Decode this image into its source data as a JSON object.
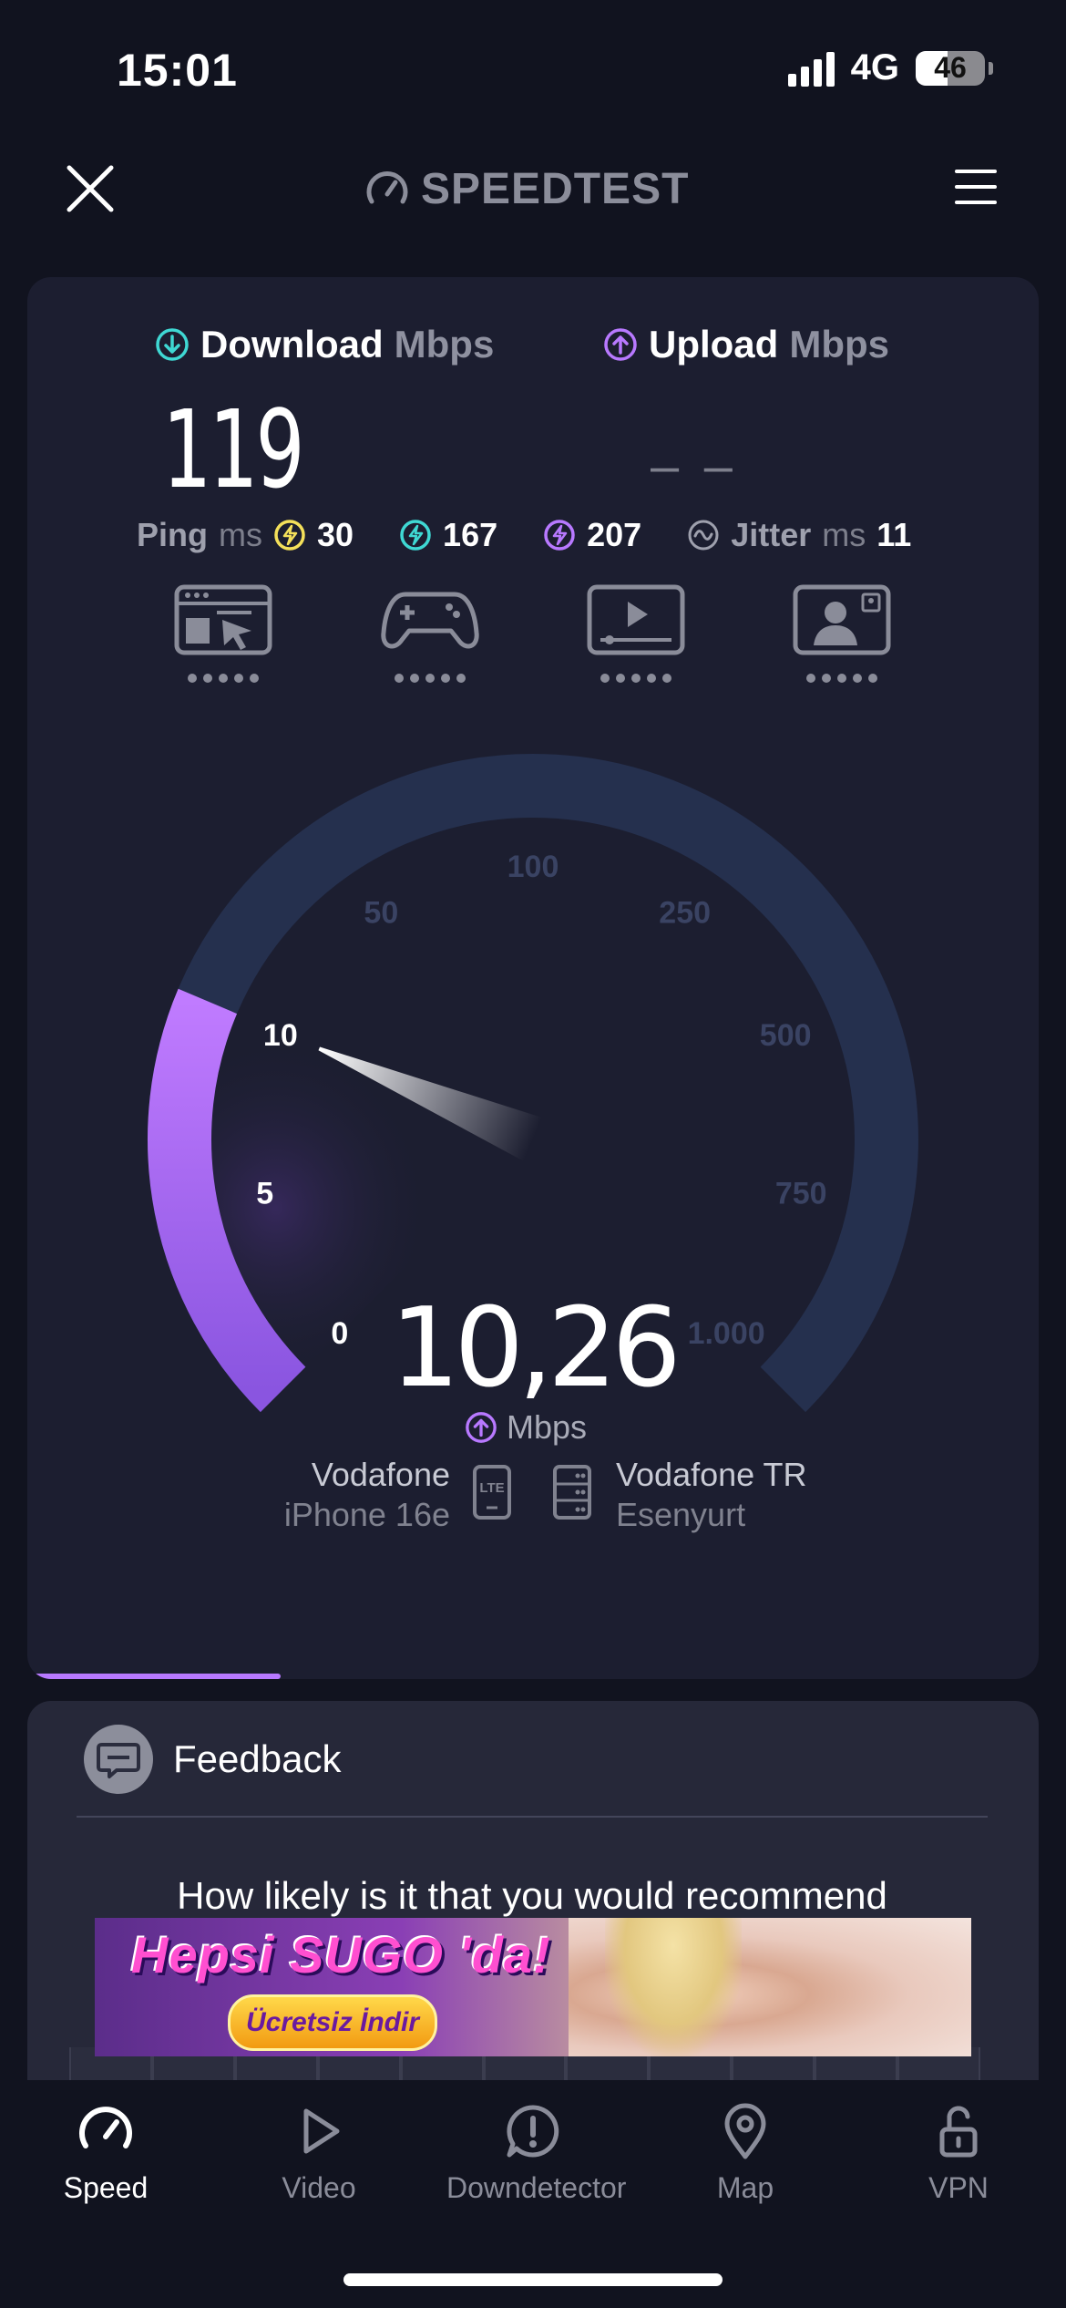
{
  "status": {
    "time": "15:01",
    "network": "4G",
    "battery": "46"
  },
  "header": {
    "brand": "SPEEDTEST"
  },
  "results": {
    "download_label": "Download",
    "download_unit": "Mbps",
    "download_value": "119",
    "upload_label": "Upload",
    "upload_unit": "Mbps",
    "upload_value": "– –",
    "ping_label": "Ping",
    "ping_unit": "ms",
    "ping_idle": "30",
    "ping_download": "167",
    "ping_upload": "207",
    "jitter_label": "Jitter",
    "jitter_unit": "ms",
    "jitter_value": "11"
  },
  "categories": [
    "web-browsing",
    "gaming",
    "video-streaming",
    "video-call"
  ],
  "gauge": {
    "ticks": [
      "0",
      "5",
      "10",
      "50",
      "100",
      "250",
      "500",
      "750",
      "1.000"
    ],
    "current_value": "10,26",
    "unit": "Mbps",
    "progress_fraction": 0.25
  },
  "connection": {
    "provider": "Vodafone",
    "device": "iPhone 16e",
    "network_icon": "LTE",
    "server_name": "Vodafone TR",
    "server_location": "Esenyurt"
  },
  "feedback": {
    "title": "Feedback",
    "question": "How likely is it that you would recommend"
  },
  "ad": {
    "headline": "Hepsi SUGO 'da!",
    "cta": "Ücretsiz İndir"
  },
  "tabs": [
    {
      "label": "Speed",
      "icon": "speed-icon"
    },
    {
      "label": "Video",
      "icon": "play-icon"
    },
    {
      "label": "Downdetector",
      "icon": "alert-icon"
    },
    {
      "label": "Map",
      "icon": "map-pin-icon"
    },
    {
      "label": "VPN",
      "icon": "lock-open-icon"
    }
  ],
  "colors": {
    "download": "#3fd8d3",
    "upload": "#b879ff",
    "ping_idle": "#f4e05a",
    "background": "#11131f"
  }
}
